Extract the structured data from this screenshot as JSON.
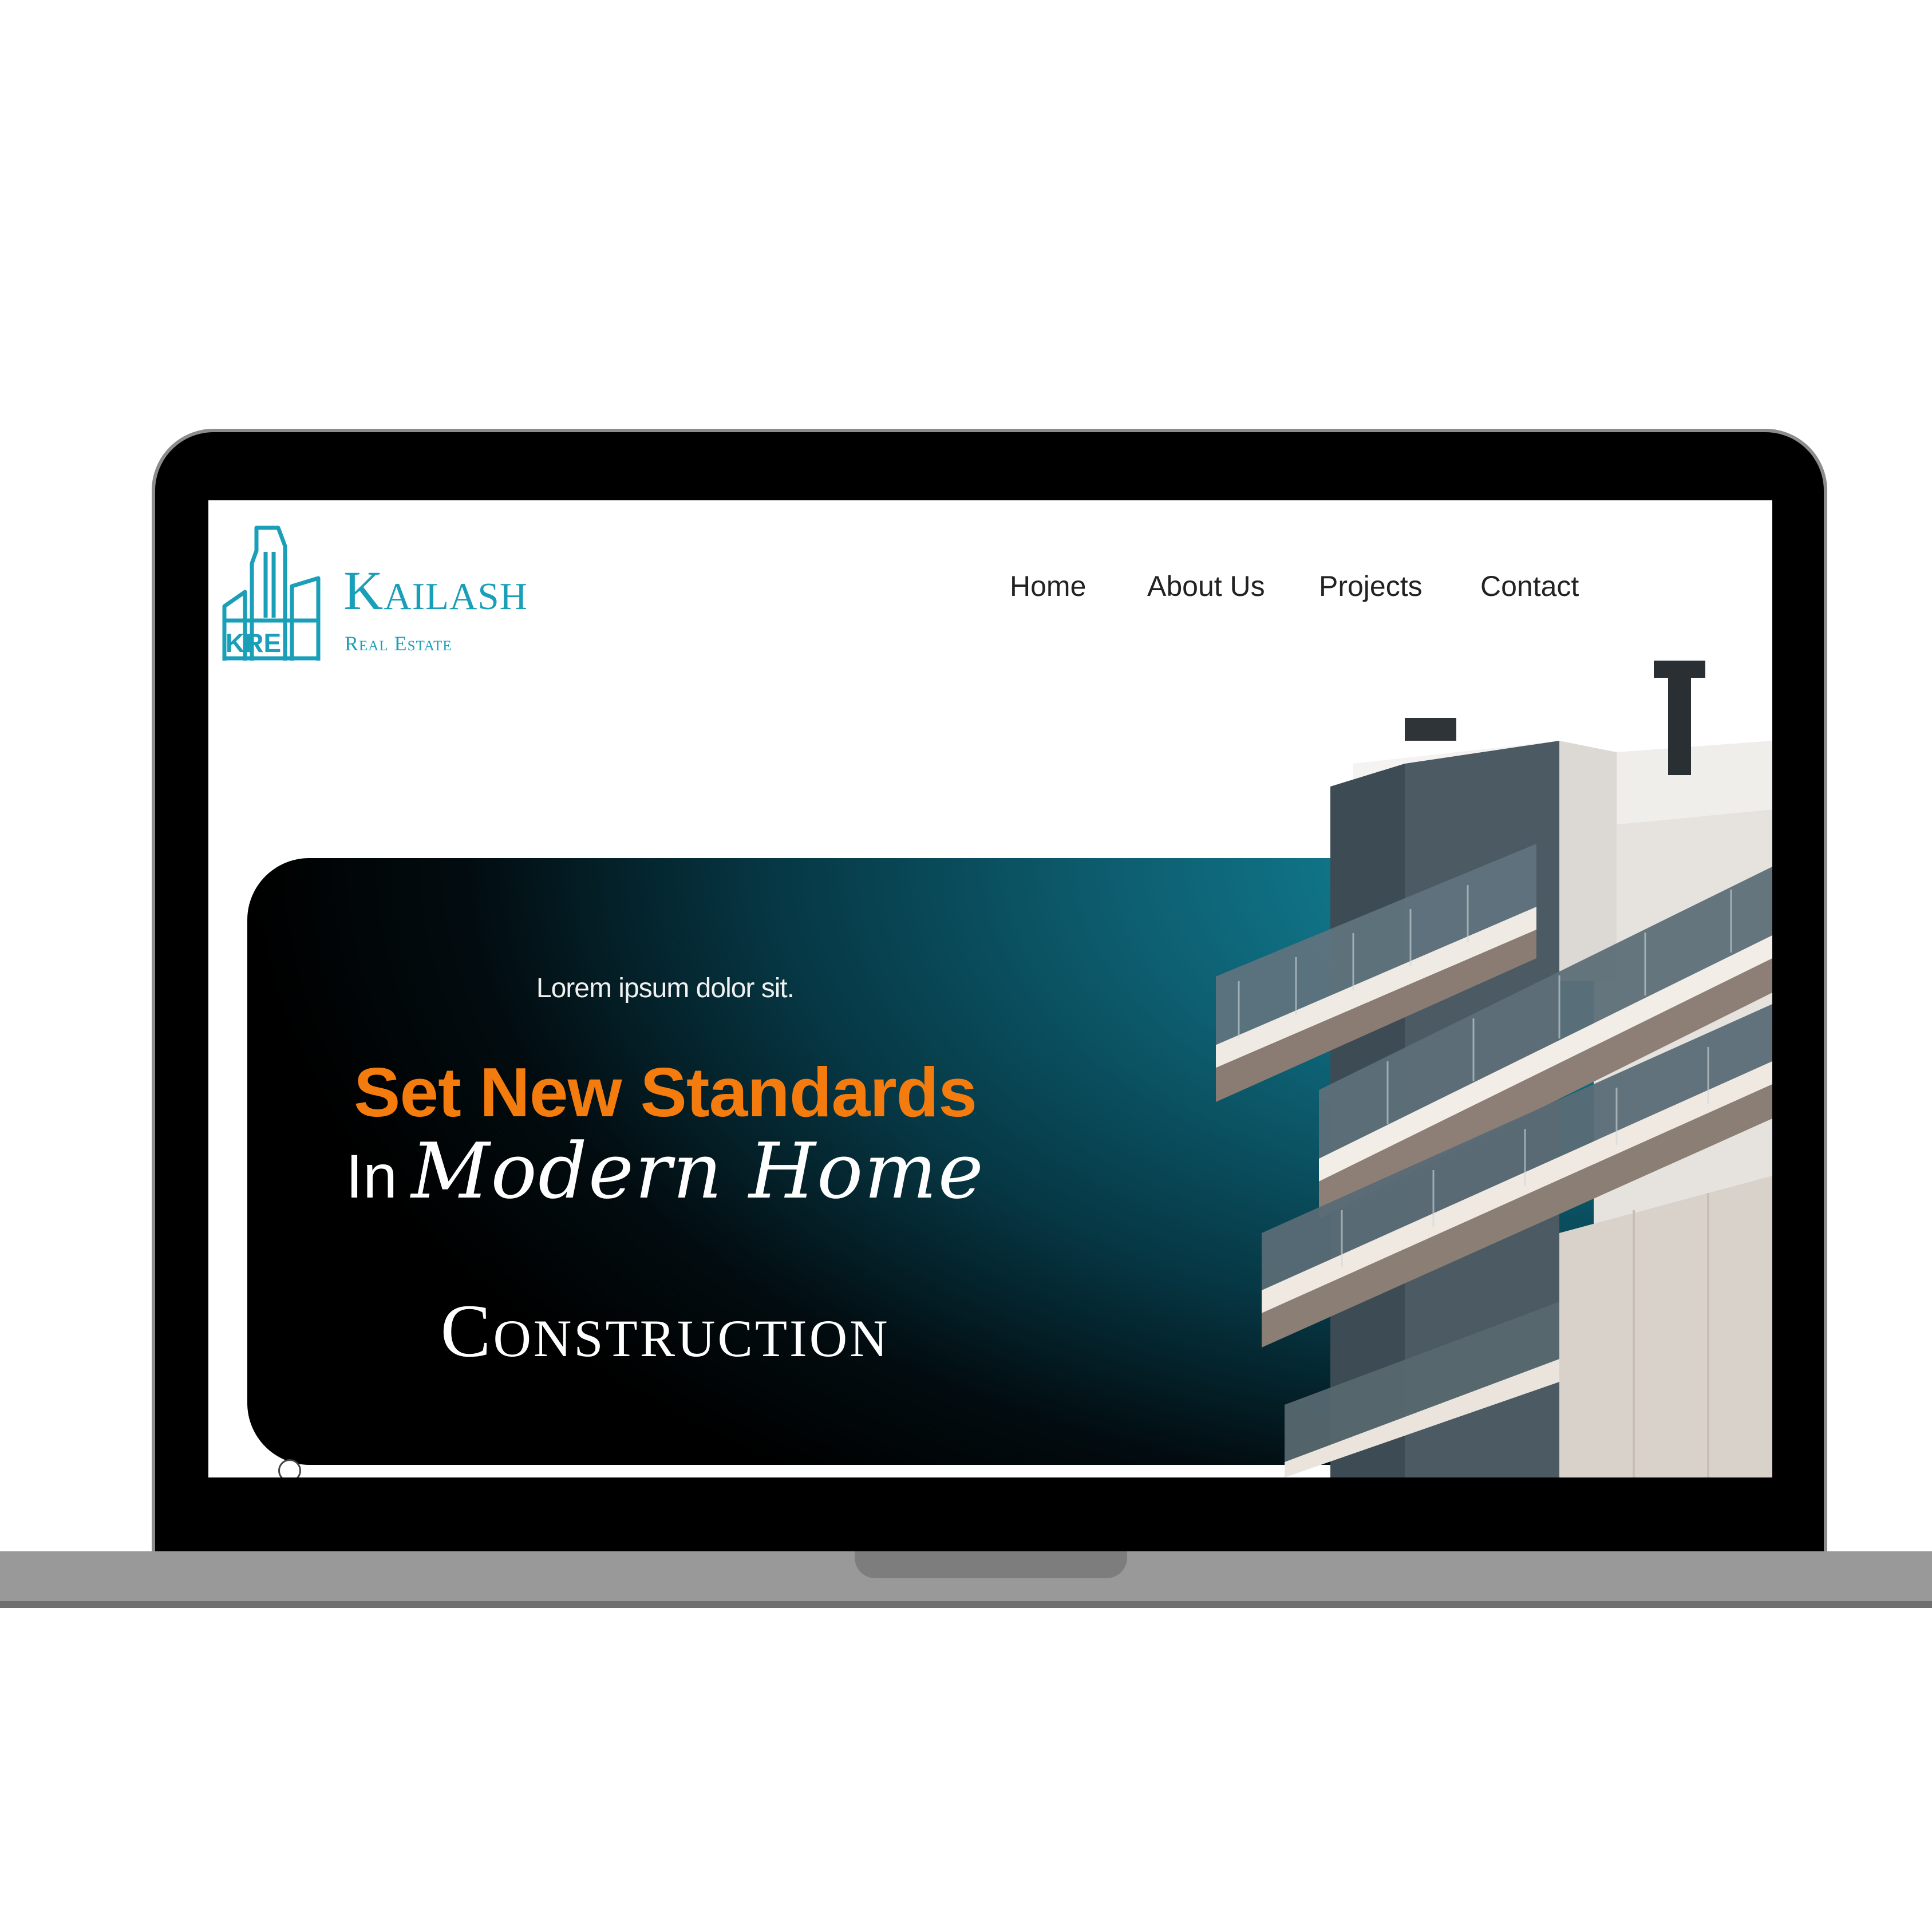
{
  "brand": {
    "name": "Kailash",
    "tagline": "Real Estate",
    "logo_monogram": "KRE",
    "color": "#1a9fb8"
  },
  "nav": {
    "items": [
      "Home",
      "About Us",
      "Projects",
      "Contact"
    ]
  },
  "hero": {
    "eyebrow": "Lorem ipsum dolor sit.",
    "headline": "Set New Standards",
    "line2_prefix": "In",
    "line2_script": "Modern Home",
    "line3": "Construction",
    "accent_color": "#f47c0f"
  }
}
